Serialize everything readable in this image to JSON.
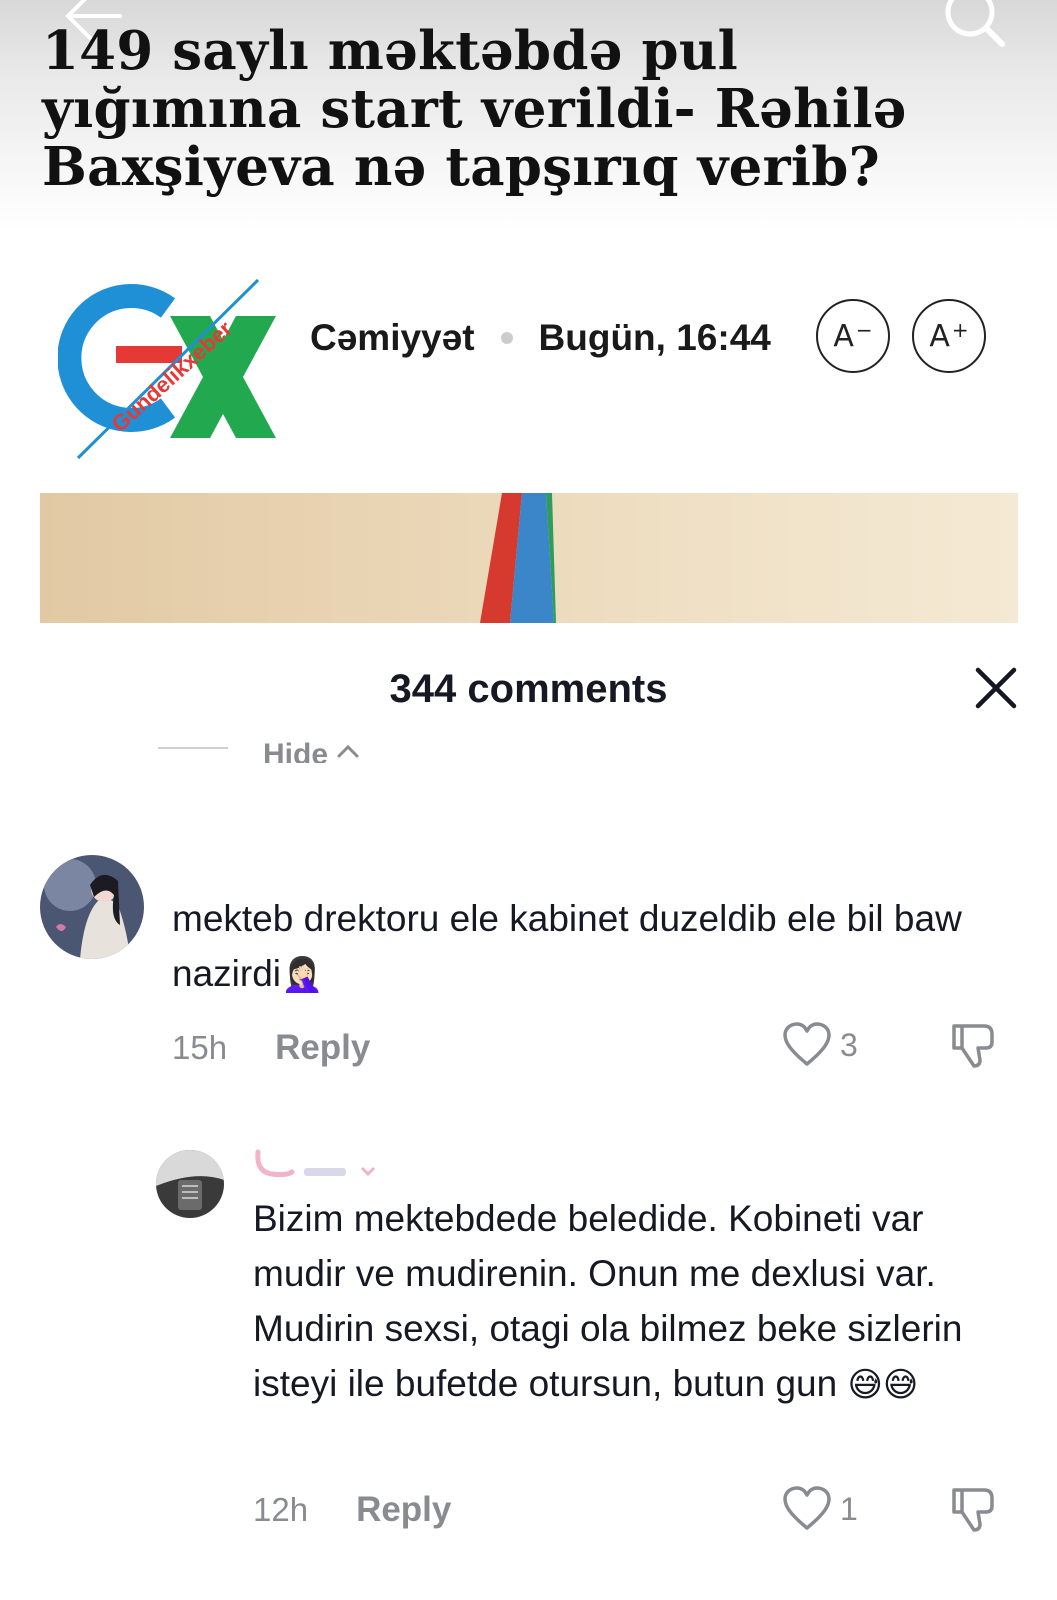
{
  "article": {
    "headline": "149 saylı məktəbdə pul yığımına start verildi- Rəhilə Baxşiyeva nə tapşırıq verib?",
    "logo_text": "Gundelikxeber",
    "category": "Cəmiyyət",
    "date": "Bugün, 16:44",
    "font_decrease_label": "A",
    "font_decrease_sup": "−",
    "font_increase_label": "A",
    "font_increase_sup": "+"
  },
  "comments_panel": {
    "title": "344 comments",
    "hide_label": "Hide",
    "reply_label": "Reply",
    "comments": [
      {
        "text": "mekteb drektoru ele kabinet duzeldib ele bil baw nazirdi",
        "emoji": "🤦🏻‍♀️",
        "time": "15h",
        "likes": "3"
      },
      {
        "text": "Bizim mektebdede beledide. Kobineti var mudir ve mudirenin. Onun me dexlusi var. Mudirin sexsi, otagi ola bilmez beke sizlerin isteyi ile bufetde otursun, butun gun",
        "emoji": "😅😅",
        "time": "12h",
        "likes": "1"
      }
    ]
  },
  "icons": {
    "back": "back-arrow-icon",
    "search": "search-icon",
    "close": "close-icon",
    "like": "heart-icon",
    "dislike": "thumbs-down-icon",
    "hide_chevron": "chevron-up-icon"
  },
  "colors": {
    "logo_blue": "#1f8fd6",
    "logo_red": "#e53935",
    "logo_green": "#22a94f",
    "secondary_text": "#8a8b91"
  }
}
